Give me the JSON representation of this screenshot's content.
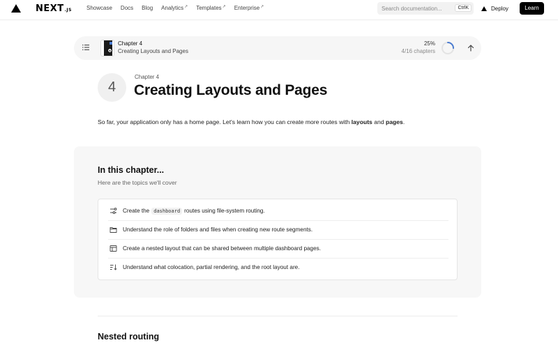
{
  "nav": {
    "logo": "NEXT",
    "logo_suffix": ".JS",
    "links": [
      {
        "label": "Showcase",
        "external": ""
      },
      {
        "label": "Docs",
        "external": ""
      },
      {
        "label": "Blog",
        "external": ""
      },
      {
        "label": "Analytics",
        "external": "↗"
      },
      {
        "label": "Templates",
        "external": "↗"
      },
      {
        "label": "Enterprise",
        "external": "↗"
      }
    ],
    "search_placeholder": "Search documentation...",
    "search_shortcut": "CtrlK",
    "deploy_label": "Deploy",
    "learn_label": "Learn"
  },
  "progress": {
    "chapter": "Chapter 4",
    "title": "Creating Layouts and Pages",
    "percent": "25%",
    "count": "4/16 chapters",
    "fraction": 0.25
  },
  "header": {
    "number": "4",
    "chapter_label": "Chapter 4",
    "title": "Creating Layouts and Pages"
  },
  "intro": {
    "text_before": "So far, your application only has a home page. Let's learn how you can create more routes with ",
    "bold1": "layouts",
    "and": " and ",
    "bold2": "pages",
    "end": "."
  },
  "chapter_card": {
    "title": "In this chapter...",
    "subtitle": "Here are the topics we'll cover",
    "topics": [
      {
        "icon": "route-icon",
        "before": "Create the",
        "code": "dashboard",
        "after": "routes using file-system routing."
      },
      {
        "icon": "folder-icon",
        "text": "Understand the role of folders and files when creating new route segments."
      },
      {
        "icon": "layout-icon",
        "text": "Create a nested layout that can be shared between multiple dashboard pages."
      },
      {
        "icon": "sort-icon",
        "text": "Understand what colocation, partial rendering, and the root layout are."
      }
    ]
  },
  "next_section": {
    "title": "Nested routing"
  },
  "colors": {
    "accent": "#000000",
    "progress_ring": "#4a7bd0",
    "card_bg": "#f7f7f7"
  }
}
